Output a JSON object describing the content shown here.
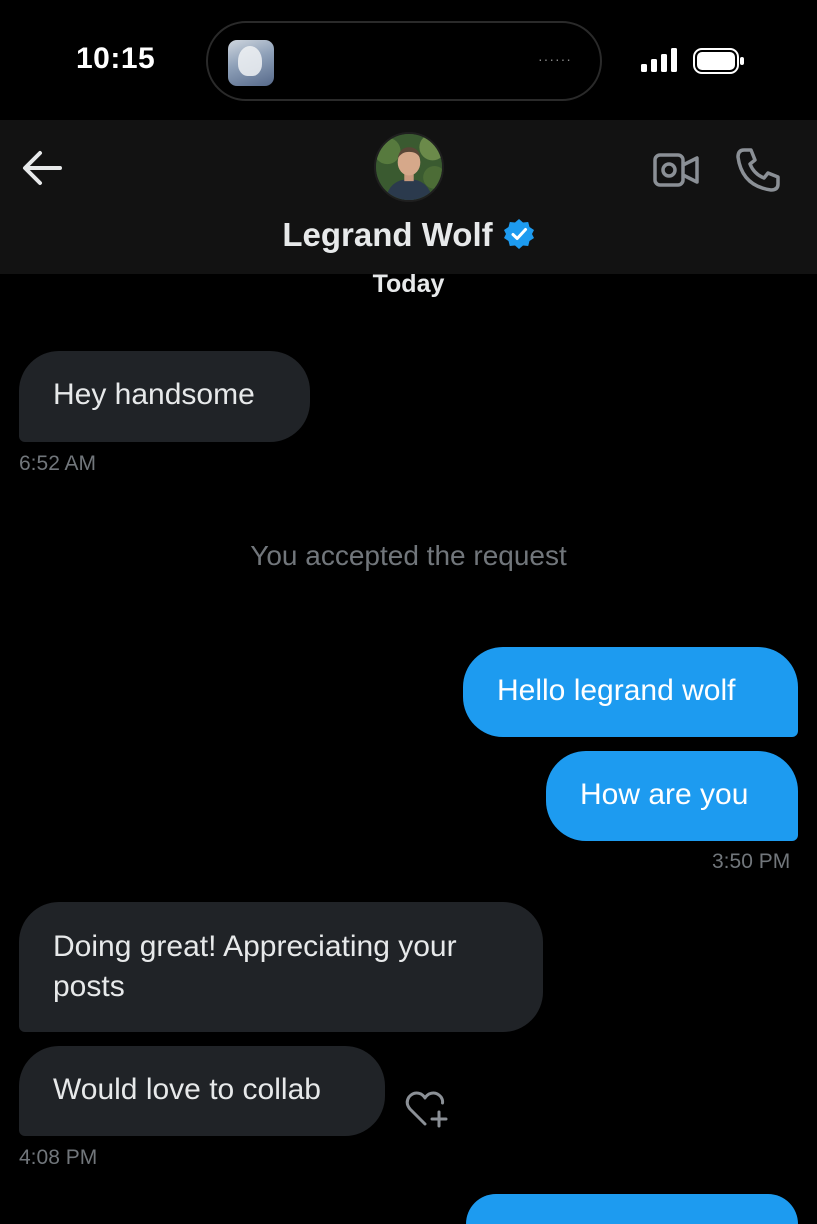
{
  "status_bar": {
    "time": "10:15",
    "island_dots": "······"
  },
  "header": {
    "contact_name": "Legrand Wolf",
    "verified": true
  },
  "conversation": {
    "date_label": "Today",
    "system_message": "You accepted the request",
    "messages": [
      {
        "direction": "received",
        "text": "Hey handsome"
      },
      {
        "direction": "sent",
        "text": "Hello legrand wolf"
      },
      {
        "direction": "sent",
        "text": "How are you"
      },
      {
        "direction": "received",
        "text": "Doing great! Appreciating your posts"
      },
      {
        "direction": "received",
        "text": "Would love to collab"
      }
    ],
    "timestamps": [
      "6:52 AM",
      "3:50 PM",
      "4:08 PM"
    ]
  },
  "colors": {
    "accent": "#1d9bf0",
    "received_bubble": "#202327",
    "header_bg": "#121212",
    "muted_text": "#71767b"
  },
  "icons": [
    "back-arrow-icon",
    "video-camera-icon",
    "phone-icon",
    "verified-badge-icon",
    "add-reaction-heart-icon",
    "signal-icon",
    "battery-icon"
  ]
}
